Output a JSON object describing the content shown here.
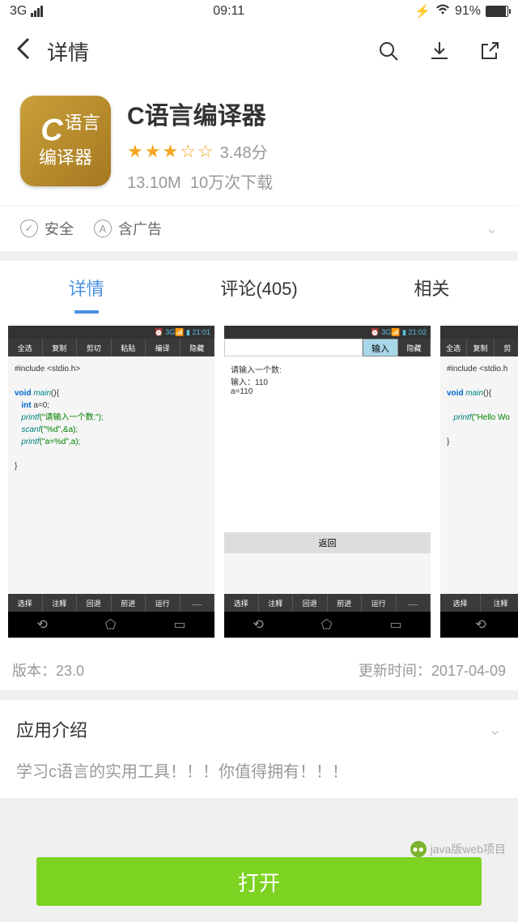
{
  "status": {
    "network": "3G",
    "time": "09:11",
    "battery": "91%"
  },
  "header": {
    "title": "详情"
  },
  "app": {
    "icon_line1": "语言",
    "icon_line2": "编译器",
    "name": "C语言编译器",
    "rating": "3.48分",
    "size": "13.10M",
    "downloads": "10万次下载"
  },
  "safety": {
    "safe": "安全",
    "ads": "含广告"
  },
  "tabs": {
    "detail": "详情",
    "comments": "评论(405)",
    "related": "相关"
  },
  "screenshots": {
    "s1": {
      "time": "21:01",
      "tools": [
        "全选",
        "复制",
        "剪切",
        "粘贴",
        "编译",
        "隐藏"
      ],
      "bottom_tools": [
        "选择",
        "注释",
        "回退",
        "前进",
        "运行",
        "....."
      ],
      "include": "#include <stdio.h>",
      "l1a": "void",
      "l1b": "main",
      "l1c": "(){",
      "l2a": "int",
      "l2b": " a=0;",
      "l3a": "printf",
      "l3b": "(\"请输入一个数:\");",
      "l4a": "scanf",
      "l4b": "(\"%d\",&a);",
      "l5a": "printf",
      "l5b": "(\"a=%d\",a);",
      "l6": "}"
    },
    "s2": {
      "time": "21:02",
      "input_btn": "输入",
      "hide": "隐藏",
      "t1": "请输入一个数:",
      "t2": "输入：110",
      "t3": "a=110",
      "return": "返回",
      "bottom_tools": [
        "选择",
        "注释",
        "回退",
        "前进",
        "运行",
        "....."
      ]
    },
    "s3": {
      "tools": [
        "全选",
        "复制",
        "剪"
      ],
      "include": "#include <stdio.h",
      "l1a": "void",
      "l1b": "main",
      "l1c": "(){",
      "l2a": "printf",
      "l2b": "(\"Hello Wo",
      "l3": "}",
      "bottom_tools": [
        "选择",
        "注释"
      ]
    }
  },
  "version": {
    "label": "版本：23.0",
    "update": "更新时间：2017-04-09"
  },
  "intro": {
    "title": "应用介绍",
    "text": "学习c语言的实用工具！！！你值得拥有！！！"
  },
  "button": {
    "open": "打开"
  },
  "watermark": "java版web项目"
}
